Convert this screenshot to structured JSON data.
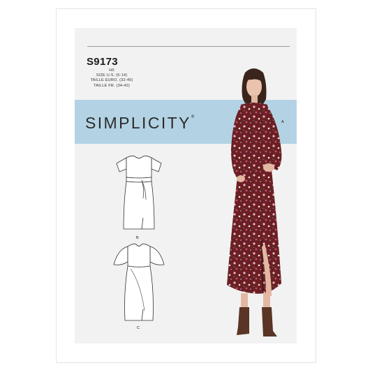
{
  "pattern": {
    "brand": "SIMPLICITY",
    "trademark": "®",
    "number": "S9173",
    "size_code": "H5",
    "sizes": [
      "SIZE U.S. (6-14)",
      "TAILLE EURO. (32-40)",
      "TAILLE FR. (34-42)"
    ]
  },
  "views": {
    "photo_view": "A",
    "sketch_b": "B",
    "sketch_c": "C"
  },
  "colors": {
    "band": "#b3d3e4",
    "dress_base": "#6b1f24",
    "boots": "#5a3424"
  },
  "icons": [
    "dress-sketch-b-icon",
    "dress-sketch-c-icon",
    "model-photo"
  ]
}
